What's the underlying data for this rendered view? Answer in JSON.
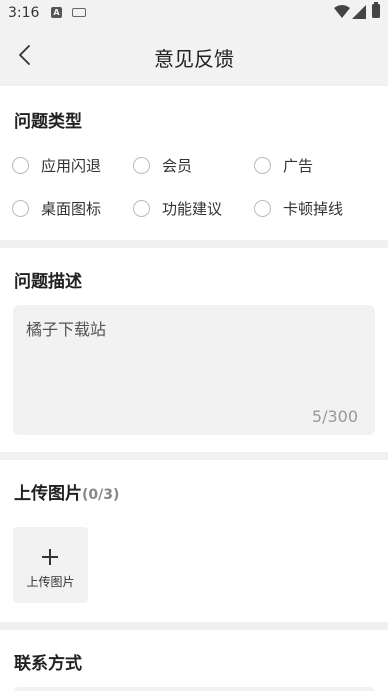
{
  "status_bar": {
    "time": "3:16",
    "notif_a": "A"
  },
  "header": {
    "title": "意见反馈"
  },
  "problem_type": {
    "title": "问题类型",
    "options": [
      "应用闪退",
      "会员",
      "广告",
      "桌面图标",
      "功能建议",
      "卡顿掉线"
    ]
  },
  "description": {
    "title": "问题描述",
    "value": "橘子下载站",
    "counter": "5/300"
  },
  "upload": {
    "title": "上传图片",
    "count": "(0/3)",
    "button_label": "上传图片"
  },
  "contact": {
    "title": "联系方式"
  },
  "colors": {
    "background": "#f0f0f0",
    "card": "#ffffff",
    "input_bg": "#f2f2f2",
    "radio_border": "#bbbbbb"
  }
}
